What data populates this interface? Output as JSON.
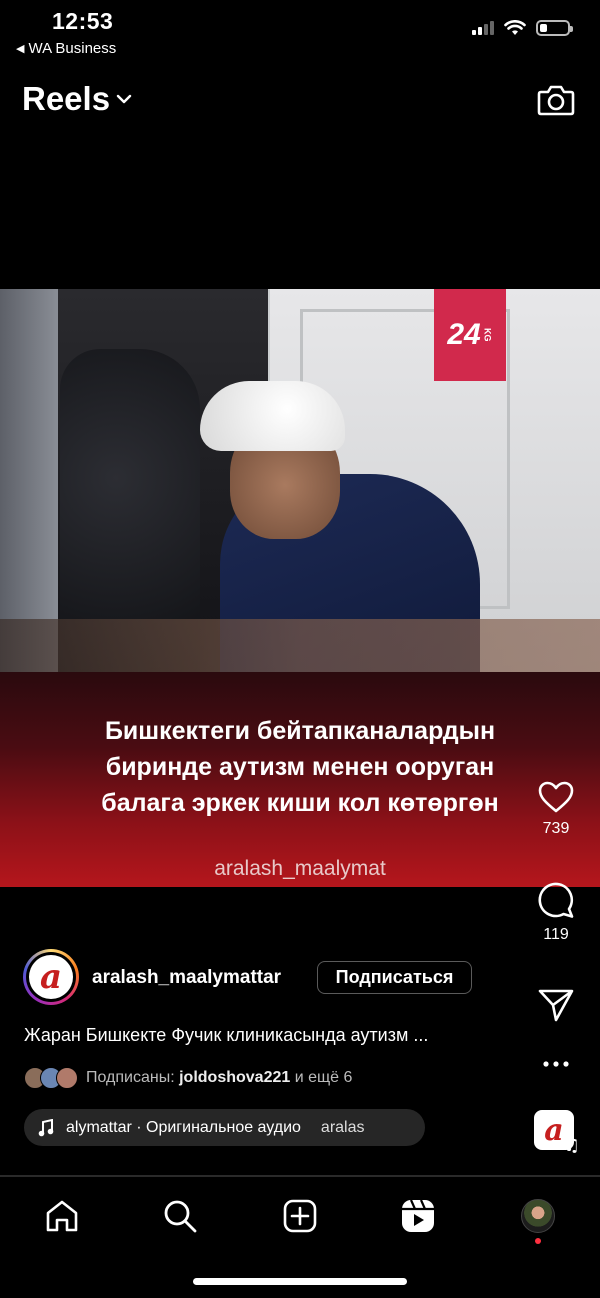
{
  "status_bar": {
    "time": "12:53",
    "back_app": "WA Business",
    "icons": [
      "cellular-signal-icon",
      "wifi-icon",
      "battery-icon"
    ],
    "battery_level": 0.25
  },
  "header": {
    "title": "Reels",
    "dropdown_icon": "chevron-down-icon",
    "camera_icon": "camera-icon"
  },
  "video": {
    "logo": "24",
    "logo_sub": "KG",
    "caption_lines": [
      "Бишкектеги бейтапканалардын",
      "биринде аутизм менен ооруган",
      "балага эркек киши кол көтөргөн"
    ],
    "watermark": "aralash_maalymat"
  },
  "actions": {
    "like_count": "739",
    "comment_count": "119",
    "icons": [
      "heart-icon",
      "comment-icon",
      "share-icon",
      "more-icon"
    ]
  },
  "author": {
    "username": "aralash_maalymattar",
    "subscribe_label": "Подписаться",
    "description": "Жаран Бишкекте Фучик клиникасында аутизм ...",
    "followers_prefix": "Подписаны: ",
    "followers_name": "joldoshova221",
    "followers_suffix": " и ещё 6"
  },
  "audio": {
    "track": "alymattar · Оригинальное аудио",
    "secondary": "aralas"
  },
  "colors": {
    "background": "#000000",
    "logo_red": "#d1294c",
    "notification_dot": "#ff3040",
    "pill_bg": "#262626"
  },
  "tabbar": {
    "tabs": [
      "home-icon",
      "search-icon",
      "create-icon",
      "reels-icon",
      "profile-avatar"
    ]
  }
}
